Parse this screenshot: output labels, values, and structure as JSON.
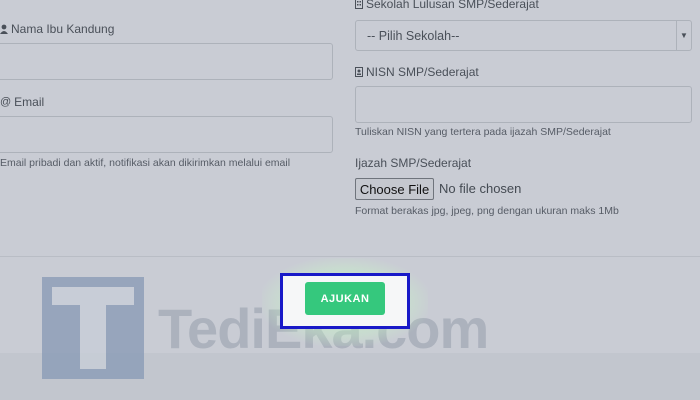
{
  "form": {
    "left": {
      "mother_name_label": "Nama Ibu Kandung",
      "email_label": "Email",
      "email_help": "Email pribadi dan aktif, notifikasi akan dikirimkan melalui email"
    },
    "right": {
      "school_label": "Sekolah Lulusan SMP/Sederajat",
      "school_select_value": "-- Pilih Sekolah--",
      "nisn_label": "NISN SMP/Sederajat",
      "nisn_help": "Tuliskan NISN yang tertera pada ijazah SMP/Sederajat",
      "ijazah_label": "Ijazah SMP/Sederajat",
      "file_button_label": "Choose File",
      "file_status": "No file chosen",
      "ijazah_help": "Format berakas jpg, jpeg, png dengan ukuran maks 1Mb"
    },
    "submit_label": "AJUKAN"
  },
  "watermark": {
    "text": "TediEka.com",
    "logo_letter": "T"
  },
  "colors": {
    "submit": "#35c87d",
    "highlight_border": "#1919c8",
    "overlay": "#c9ccd4"
  },
  "icons": {
    "mother_name": "person-icon",
    "email": "at-icon",
    "school": "building-icon",
    "nisn": "id-card-icon",
    "select_arrow": "caret-down-icon"
  }
}
